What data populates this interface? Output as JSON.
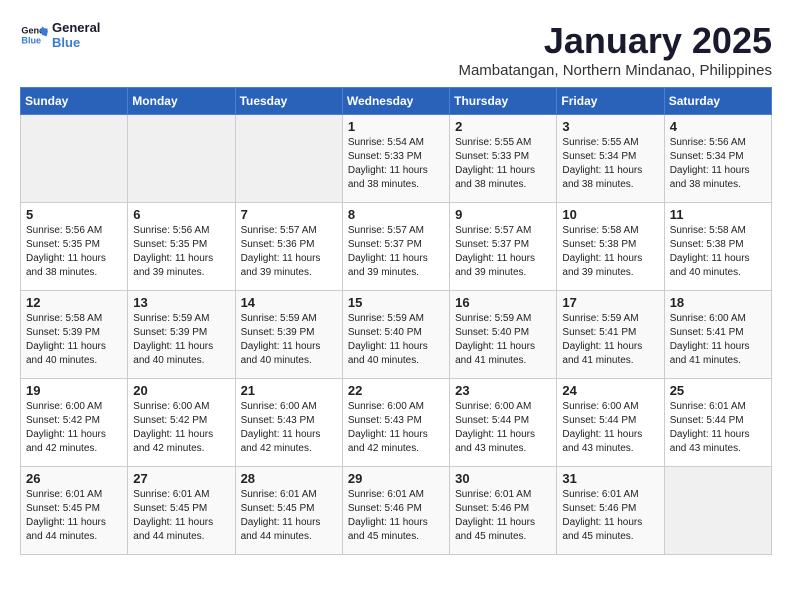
{
  "logo": {
    "line1": "General",
    "line2": "Blue"
  },
  "title": "January 2025",
  "subtitle": "Mambatangan, Northern Mindanao, Philippines",
  "days_of_week": [
    "Sunday",
    "Monday",
    "Tuesday",
    "Wednesday",
    "Thursday",
    "Friday",
    "Saturday"
  ],
  "weeks": [
    [
      {
        "day": "",
        "info": ""
      },
      {
        "day": "",
        "info": ""
      },
      {
        "day": "",
        "info": ""
      },
      {
        "day": "1",
        "info": "Sunrise: 5:54 AM\nSunset: 5:33 PM\nDaylight: 11 hours\nand 38 minutes."
      },
      {
        "day": "2",
        "info": "Sunrise: 5:55 AM\nSunset: 5:33 PM\nDaylight: 11 hours\nand 38 minutes."
      },
      {
        "day": "3",
        "info": "Sunrise: 5:55 AM\nSunset: 5:34 PM\nDaylight: 11 hours\nand 38 minutes."
      },
      {
        "day": "4",
        "info": "Sunrise: 5:56 AM\nSunset: 5:34 PM\nDaylight: 11 hours\nand 38 minutes."
      }
    ],
    [
      {
        "day": "5",
        "info": "Sunrise: 5:56 AM\nSunset: 5:35 PM\nDaylight: 11 hours\nand 38 minutes."
      },
      {
        "day": "6",
        "info": "Sunrise: 5:56 AM\nSunset: 5:35 PM\nDaylight: 11 hours\nand 39 minutes."
      },
      {
        "day": "7",
        "info": "Sunrise: 5:57 AM\nSunset: 5:36 PM\nDaylight: 11 hours\nand 39 minutes."
      },
      {
        "day": "8",
        "info": "Sunrise: 5:57 AM\nSunset: 5:37 PM\nDaylight: 11 hours\nand 39 minutes."
      },
      {
        "day": "9",
        "info": "Sunrise: 5:57 AM\nSunset: 5:37 PM\nDaylight: 11 hours\nand 39 minutes."
      },
      {
        "day": "10",
        "info": "Sunrise: 5:58 AM\nSunset: 5:38 PM\nDaylight: 11 hours\nand 39 minutes."
      },
      {
        "day": "11",
        "info": "Sunrise: 5:58 AM\nSunset: 5:38 PM\nDaylight: 11 hours\nand 40 minutes."
      }
    ],
    [
      {
        "day": "12",
        "info": "Sunrise: 5:58 AM\nSunset: 5:39 PM\nDaylight: 11 hours\nand 40 minutes."
      },
      {
        "day": "13",
        "info": "Sunrise: 5:59 AM\nSunset: 5:39 PM\nDaylight: 11 hours\nand 40 minutes."
      },
      {
        "day": "14",
        "info": "Sunrise: 5:59 AM\nSunset: 5:39 PM\nDaylight: 11 hours\nand 40 minutes."
      },
      {
        "day": "15",
        "info": "Sunrise: 5:59 AM\nSunset: 5:40 PM\nDaylight: 11 hours\nand 40 minutes."
      },
      {
        "day": "16",
        "info": "Sunrise: 5:59 AM\nSunset: 5:40 PM\nDaylight: 11 hours\nand 41 minutes."
      },
      {
        "day": "17",
        "info": "Sunrise: 5:59 AM\nSunset: 5:41 PM\nDaylight: 11 hours\nand 41 minutes."
      },
      {
        "day": "18",
        "info": "Sunrise: 6:00 AM\nSunset: 5:41 PM\nDaylight: 11 hours\nand 41 minutes."
      }
    ],
    [
      {
        "day": "19",
        "info": "Sunrise: 6:00 AM\nSunset: 5:42 PM\nDaylight: 11 hours\nand 42 minutes."
      },
      {
        "day": "20",
        "info": "Sunrise: 6:00 AM\nSunset: 5:42 PM\nDaylight: 11 hours\nand 42 minutes."
      },
      {
        "day": "21",
        "info": "Sunrise: 6:00 AM\nSunset: 5:43 PM\nDaylight: 11 hours\nand 42 minutes."
      },
      {
        "day": "22",
        "info": "Sunrise: 6:00 AM\nSunset: 5:43 PM\nDaylight: 11 hours\nand 42 minutes."
      },
      {
        "day": "23",
        "info": "Sunrise: 6:00 AM\nSunset: 5:44 PM\nDaylight: 11 hours\nand 43 minutes."
      },
      {
        "day": "24",
        "info": "Sunrise: 6:00 AM\nSunset: 5:44 PM\nDaylight: 11 hours\nand 43 minutes."
      },
      {
        "day": "25",
        "info": "Sunrise: 6:01 AM\nSunset: 5:44 PM\nDaylight: 11 hours\nand 43 minutes."
      }
    ],
    [
      {
        "day": "26",
        "info": "Sunrise: 6:01 AM\nSunset: 5:45 PM\nDaylight: 11 hours\nand 44 minutes."
      },
      {
        "day": "27",
        "info": "Sunrise: 6:01 AM\nSunset: 5:45 PM\nDaylight: 11 hours\nand 44 minutes."
      },
      {
        "day": "28",
        "info": "Sunrise: 6:01 AM\nSunset: 5:45 PM\nDaylight: 11 hours\nand 44 minutes."
      },
      {
        "day": "29",
        "info": "Sunrise: 6:01 AM\nSunset: 5:46 PM\nDaylight: 11 hours\nand 45 minutes."
      },
      {
        "day": "30",
        "info": "Sunrise: 6:01 AM\nSunset: 5:46 PM\nDaylight: 11 hours\nand 45 minutes."
      },
      {
        "day": "31",
        "info": "Sunrise: 6:01 AM\nSunset: 5:46 PM\nDaylight: 11 hours\nand 45 minutes."
      },
      {
        "day": "",
        "info": ""
      }
    ]
  ]
}
